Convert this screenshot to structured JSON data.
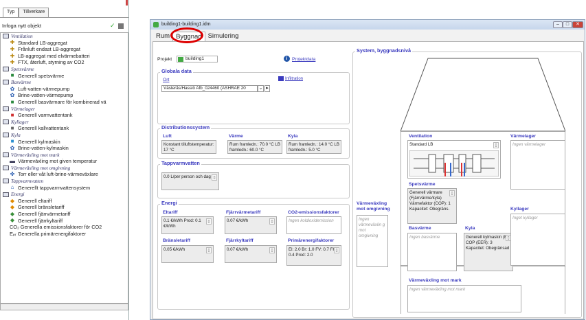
{
  "left_panel": {
    "tabs": [
      "Typ",
      "Tillverkare"
    ],
    "insert_label": "Infoga nytt objekt",
    "tree": [
      {
        "kind": "cat",
        "label": "Ventilation"
      },
      {
        "kind": "it",
        "icon": "fan-icon",
        "glyph": "✚",
        "color": "#b8860b",
        "label": "Standard LB-aggregat"
      },
      {
        "kind": "it",
        "icon": "fan-icon",
        "glyph": "✚",
        "color": "#b8860b",
        "label": "Frånluft endast LB-aggregat"
      },
      {
        "kind": "it",
        "icon": "fan-icon",
        "glyph": "✚",
        "color": "#b8860b",
        "label": "LB-aggregat med elvärmebatteri"
      },
      {
        "kind": "it",
        "icon": "fan-icon",
        "glyph": "✚",
        "color": "#b8860b",
        "label": "FTX, återluft, styrning av CO2"
      },
      {
        "kind": "cat",
        "label": "Spetsvärme"
      },
      {
        "kind": "it",
        "icon": "heater-icon",
        "glyph": "■",
        "color": "#2b8a3e",
        "label": "Generell spetsvärme"
      },
      {
        "kind": "cat",
        "label": "Basvärme"
      },
      {
        "kind": "it",
        "icon": "heatpump-icon",
        "glyph": "✿",
        "color": "#2a5db0",
        "label": "Luft-vatten-värmepump"
      },
      {
        "kind": "it",
        "icon": "heatpump-icon",
        "glyph": "✿",
        "color": "#2a5db0",
        "label": "Brine-vatten-värmepump"
      },
      {
        "kind": "it",
        "icon": "heater-icon",
        "glyph": "■",
        "color": "#2b8a3e",
        "label": "Generell basvärmare för kombinerad vä"
      },
      {
        "kind": "cat",
        "label": "Värmelager"
      },
      {
        "kind": "it",
        "icon": "tank-icon",
        "glyph": "■",
        "color": "#d03030",
        "label": "Generell varmvattentank"
      },
      {
        "kind": "cat",
        "label": "Kyllager"
      },
      {
        "kind": "it",
        "icon": "tank-icon",
        "glyph": "■",
        "color": "#666",
        "label": "Generell kallvattentank"
      },
      {
        "kind": "cat",
        "label": "Kyla"
      },
      {
        "kind": "it",
        "icon": "cooler-icon",
        "glyph": "■",
        "color": "#2a8fd0",
        "label": "Generell kylmaskin"
      },
      {
        "kind": "it",
        "icon": "heatpump-icon",
        "glyph": "✿",
        "color": "#2a5db0",
        "label": "Brine-vatten-kylmaskin"
      },
      {
        "kind": "cat",
        "label": "Värmeväxling mot mark"
      },
      {
        "kind": "it",
        "icon": "ground-exchange-icon",
        "glyph": "▬",
        "color": "#224",
        "label": "Värmeväxling mot given temperatur"
      },
      {
        "kind": "cat",
        "label": "Värmeväxling mot omgivning"
      },
      {
        "kind": "it",
        "icon": "exchanger-icon",
        "glyph": "✤",
        "color": "#2a5db0",
        "label": "Torr eller våt luft-brine-värmeväxlare"
      },
      {
        "kind": "cat",
        "label": "Tappvarmvatten"
      },
      {
        "kind": "it",
        "icon": "faucet-icon",
        "glyph": "⌂",
        "color": "#2a5db0",
        "label": "Generellt tappvarmvattensystem"
      },
      {
        "kind": "cat",
        "label": "Energi"
      },
      {
        "kind": "it",
        "icon": "electricity-icon",
        "glyph": "◆",
        "color": "#e08a00",
        "label": "Generell eltariff"
      },
      {
        "kind": "it",
        "icon": "fuel-icon",
        "glyph": "◆",
        "color": "#e08a00",
        "label": "Generell bränsletariff"
      },
      {
        "kind": "it",
        "icon": "district-heat-icon",
        "glyph": "◆",
        "color": "#3a8f3a",
        "label": "Generell fjärrvärmetariff"
      },
      {
        "kind": "it",
        "icon": "district-cool-icon",
        "glyph": "◆",
        "color": "#3a8f3a",
        "label": "Generell fjärrkyltariff"
      },
      {
        "kind": "it",
        "icon": "co2-icon",
        "glyph": "",
        "color": "#555",
        "label": "CO₂ Generella emissionsfaktorer för CO2"
      },
      {
        "kind": "it",
        "icon": "primary-energy-icon",
        "glyph": "",
        "color": "#555",
        "label": "Eₚᵣ Generella primärenergifaktorer"
      }
    ]
  },
  "window": {
    "title": "building1-building1.idm",
    "tabs": [
      "Rum",
      "Byggnad",
      "Simulering"
    ],
    "project_label": "Projekt",
    "project_value": "building1",
    "project_data_link": "Projektdata",
    "global": {
      "title": "Globala data",
      "place_label": "Ort",
      "infiltration_link": "Infiltration",
      "place_value": "Västerås/Hasslö Afb_024460 (ASHRAE 20"
    },
    "dist": {
      "title": "Distributionssystem",
      "luft": "Luft",
      "varme": "Värme",
      "kyla": "Kyla",
      "luft_text": "Konstant tilluftstemperatur: 17 °C",
      "varme_text": "Rum framledn.: 70.0 °C LB framledn.: 60.0 °C",
      "kyla_text": "Rum framledn.: 14.0 °C LB framledn.: 5.0 °C"
    },
    "tap": {
      "title": "Tappvarmvatten",
      "value": "0.0 L/per person och dag"
    },
    "energy": {
      "title": "Energi",
      "el_label": "Eltariff",
      "el_value": "0.1 €/kWh Prod: 0.1 €/kWh",
      "fv_label": "Fjärrvärmetariff",
      "fv_value": "0.07 €/kWh",
      "co2_label": "CO2-emissionsfaktorer",
      "co2_value": "Ingen koldioxidemission",
      "br_label": "Bränsletariff",
      "br_value": "0.05 €/kWh",
      "fk_label": "Fjärrkyltariff",
      "fk_value": "0.07 €/kWh",
      "pe_label": "Primärenergifaktorer",
      "pe_value": "El: 2.0 Br: 1.0 FV: 0.7 FK: 0.4 Prod: 2.0"
    },
    "system": {
      "title": "System, byggnadsnivå",
      "vent_label": "Ventilation",
      "vent_value": "Standard LB",
      "vlager_label": "Värmelager",
      "vlager_value": "Ingen värmelager",
      "spets_label": "Spetsvärme",
      "spets_value": "Generell värmare (Fjärrvärme/kyla)",
      "spets_value2": "Värmefaktor (COP): 1 Kapacitet: Obegräns.",
      "vvx_omg_label": "Värmeväxling mot omgivning",
      "vvx_omg_value": "Ingen värmeväxlin g mot omgivning",
      "bas_label": "Basvärme",
      "bas_value": "Ingen basvärme",
      "kyla_label": "Kyla",
      "kyla_value": "Generell kylmaskin (El)",
      "kyla_value2": "COP (EER): 3 Kapacitet: Obegränsad",
      "kyllager_label": "Kyllager",
      "kyllager_value": "Inget kyllager",
      "mark_label": "Värmeväxling mot mark",
      "mark_value": "Ingen värmeväxling mot mark"
    }
  }
}
